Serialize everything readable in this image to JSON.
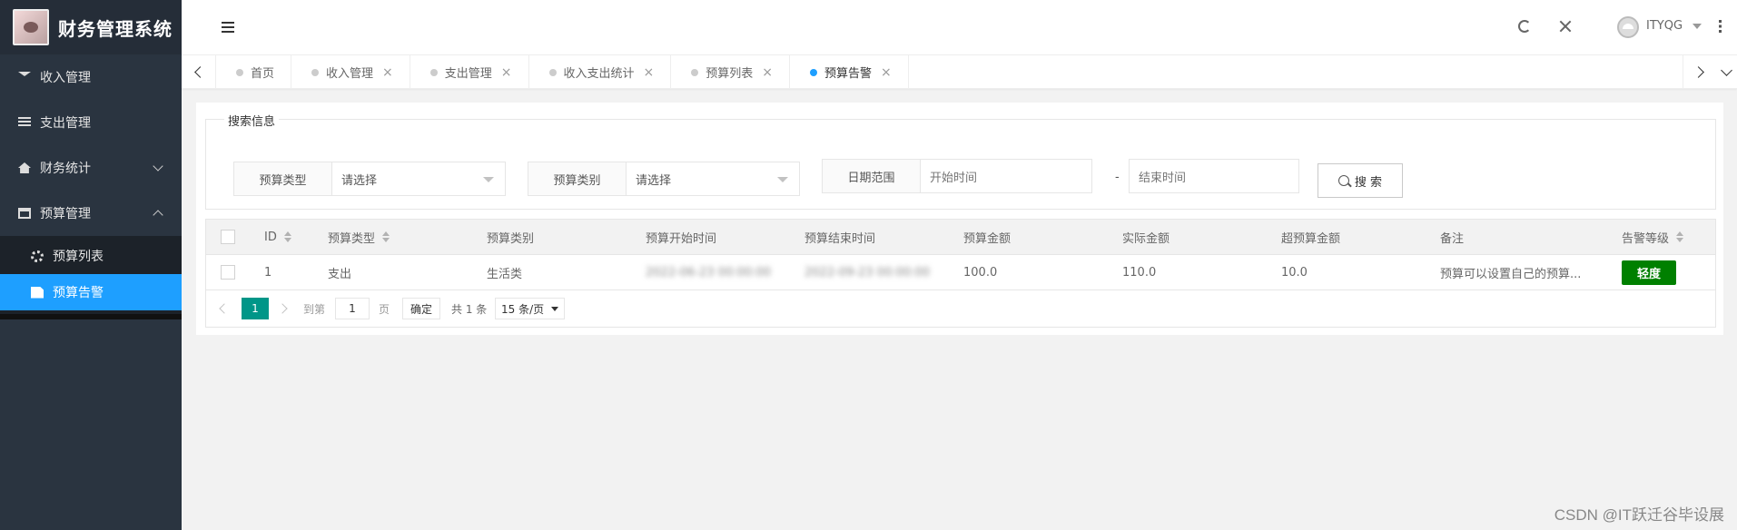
{
  "app": {
    "title": "财务管理系统"
  },
  "sidebar": {
    "items": [
      {
        "label": "收入管理",
        "icon": "graduation-cap-icon"
      },
      {
        "label": "支出管理",
        "icon": "list-icon"
      },
      {
        "label": "财务统计",
        "icon": "home-icon",
        "expanded": false
      },
      {
        "label": "预算管理",
        "icon": "window-icon",
        "expanded": true
      }
    ],
    "subitems": [
      {
        "label": "预算列表",
        "icon": "gears-icon"
      },
      {
        "label": "预算告警",
        "icon": "file-icon",
        "active": true
      }
    ]
  },
  "header": {
    "username": "ITYQG"
  },
  "tabs": [
    {
      "label": "首页"
    },
    {
      "label": "收入管理"
    },
    {
      "label": "支出管理"
    },
    {
      "label": "收入支出统计"
    },
    {
      "label": "预算列表"
    },
    {
      "label": "预算告警",
      "active": true
    }
  ],
  "search": {
    "legend": "搜索信息",
    "type_label": "预算类型",
    "type_value": "请选择",
    "category_label": "预算类别",
    "category_value": "请选择",
    "date_label": "日期范围",
    "start_placeholder": "开始时间",
    "separator": "-",
    "end_placeholder": "结束时间",
    "button": "搜 索"
  },
  "table": {
    "headers": [
      "ID",
      "预算类型",
      "预算类别",
      "预算开始时间",
      "预算结束时间",
      "预算金额",
      "实际金额",
      "超预算金额",
      "备注",
      "告警等级"
    ],
    "rows": [
      {
        "id": "1",
        "type": "支出",
        "category": "生活类",
        "start": "2022-06-23 00:00:00",
        "end": "2022-09-23 00:00:00",
        "budget": "100.0",
        "actual": "110.0",
        "over": "10.0",
        "note": "预算可以设置自己的预算...",
        "level": "轻度"
      }
    ]
  },
  "pager": {
    "current": "1",
    "goto_label": "到第",
    "goto_value": "1",
    "page_unit": "页",
    "confirm": "确定",
    "total": "共 1 条",
    "page_size": "15 条/页"
  },
  "watermark": "CSDN @IT跃迁谷毕设展",
  "colors": {
    "sidebar_bg": "#2a3440",
    "active": "#1e9fff",
    "pager_active": "#009688",
    "badge": "#008000"
  }
}
